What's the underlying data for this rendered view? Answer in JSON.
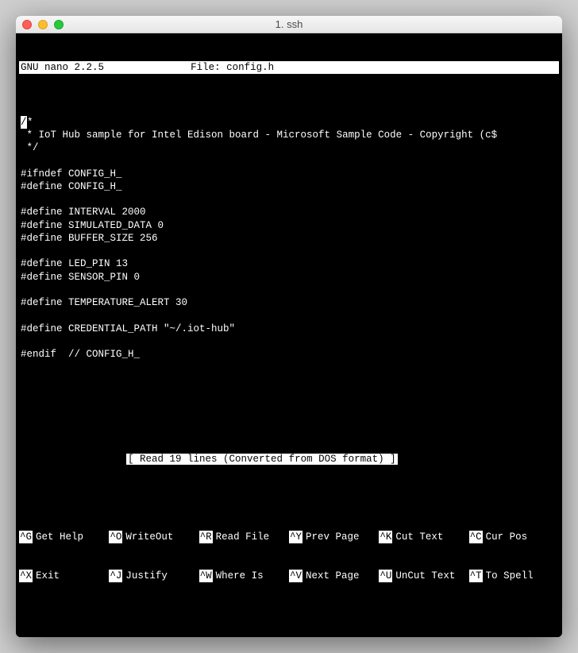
{
  "window": {
    "title": "1. ssh"
  },
  "nano": {
    "version": "GNU nano 2.2.5",
    "file_label": "File: config.h",
    "status": "[ Read 19 lines (Converted from DOS format) ]"
  },
  "code": {
    "l00a": "/",
    "l00b": "*",
    "l01": " * IoT Hub sample for Intel Edison board - Microsoft Sample Code - Copyright (c$",
    "l02": " */",
    "l03": "",
    "l04": "#ifndef CONFIG_H_",
    "l05": "#define CONFIG_H_",
    "l06": "",
    "l07": "#define INTERVAL 2000",
    "l08": "#define SIMULATED_DATA 0",
    "l09": "#define BUFFER_SIZE 256",
    "l10": "",
    "l11": "#define LED_PIN 13",
    "l12": "#define SENSOR_PIN 0",
    "l13": "",
    "l14": "#define TEMPERATURE_ALERT 30",
    "l15": "",
    "l16": "#define CREDENTIAL_PATH \"~/.iot-hub\"",
    "l17": "",
    "l18": "#endif  // CONFIG_H_",
    "l19": ""
  },
  "shortcuts": {
    "r1": {
      "k1": "^G",
      "l1": "Get Help",
      "k2": "^O",
      "l2": "WriteOut",
      "k3": "^R",
      "l3": "Read File",
      "k4": "^Y",
      "l4": "Prev Page",
      "k5": "^K",
      "l5": "Cut Text",
      "k6": "^C",
      "l6": "Cur Pos"
    },
    "r2": {
      "k1": "^X",
      "l1": "Exit",
      "k2": "^J",
      "l2": "Justify",
      "k3": "^W",
      "l3": "Where Is",
      "k4": "^V",
      "l4": "Next Page",
      "k5": "^U",
      "l5": "UnCut Text",
      "k6": "^T",
      "l6": "To Spell"
    }
  }
}
